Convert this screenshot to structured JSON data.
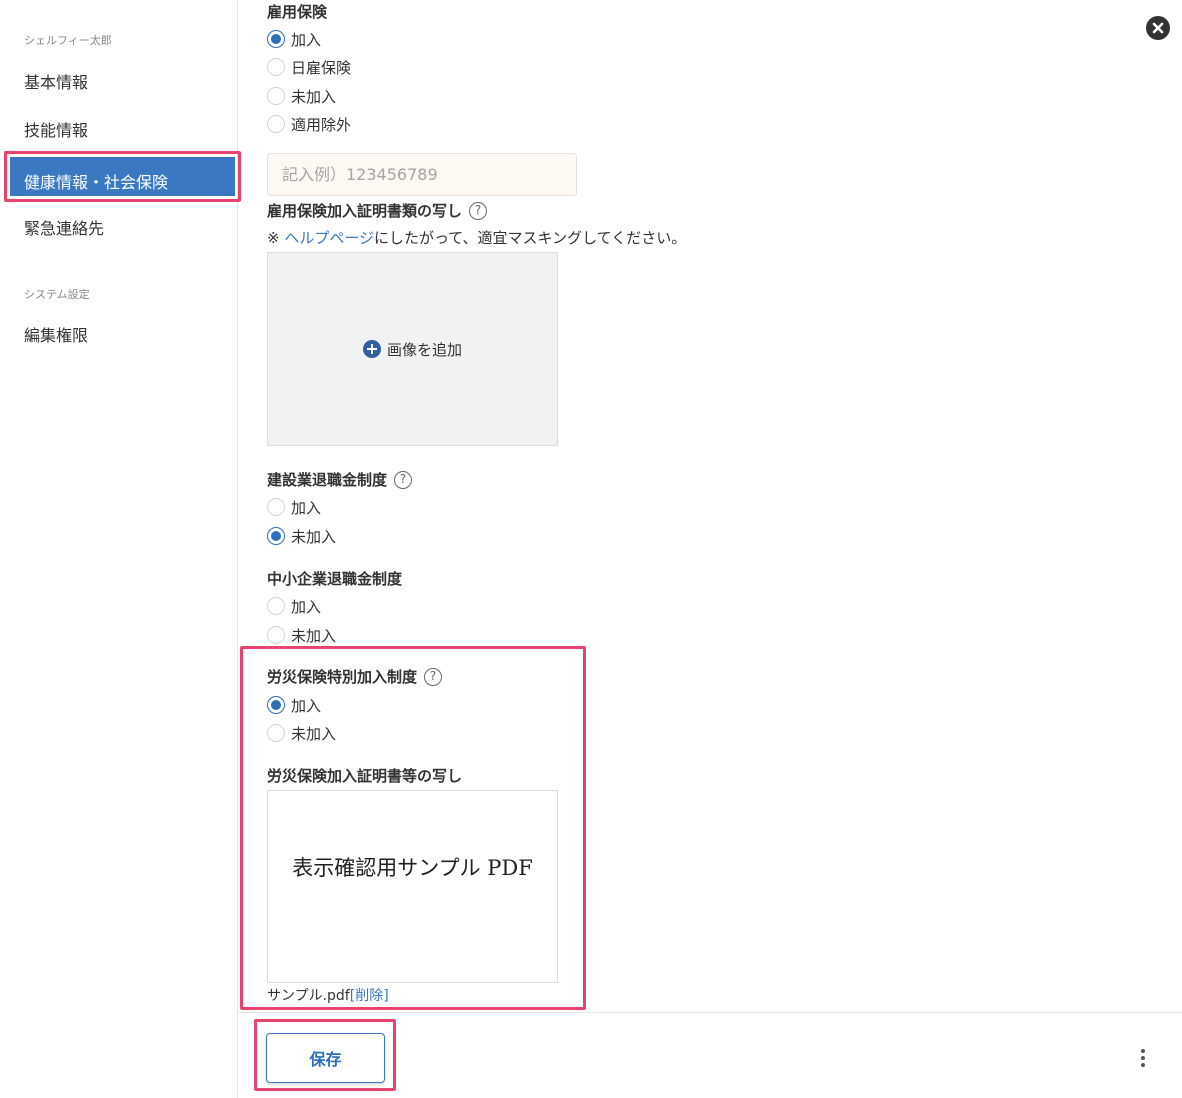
{
  "sidebar": {
    "section_user": "シェルフィー太郎",
    "items": [
      {
        "label": "基本情報"
      },
      {
        "label": "技能情報"
      },
      {
        "label": "健康情報・社会保険"
      },
      {
        "label": "緊急連絡先"
      }
    ],
    "section_system": "システム設定",
    "system_items": [
      {
        "label": "編集権限"
      }
    ]
  },
  "employment_insurance": {
    "title": "雇用保険",
    "options": [
      "加入",
      "日雇保険",
      "未加入",
      "適用除外"
    ],
    "selected": "加入",
    "number_placeholder": "記入例）123456789",
    "doc_title": "雇用保険加入証明書類の写し",
    "note_prefix": "※ ",
    "note_link": "ヘルプページ",
    "note_suffix": "にしたがって、適宜マスキングしてください。",
    "add_image_label": "画像を追加"
  },
  "construction_retirement": {
    "title": "建設業退職金制度",
    "options": [
      "加入",
      "未加入"
    ],
    "selected": "未加入"
  },
  "sme_retirement": {
    "title": "中小企業退職金制度",
    "options": [
      "加入",
      "未加入"
    ],
    "selected": ""
  },
  "workers_comp": {
    "title": "労災保険特別加入制度",
    "options": [
      "加入",
      "未加入"
    ],
    "selected": "加入",
    "doc_title": "労災保険加入証明書等の写し",
    "pdf_preview_text": "表示確認用サンプル PDF",
    "file_name": "サンプル.pdf",
    "delete_label": "[削除]"
  },
  "footer": {
    "save_label": "保存"
  },
  "icons": {
    "close": "close-icon",
    "help": "help-icon",
    "plus": "plus-circle-icon",
    "more": "more-vertical-icon"
  },
  "colors": {
    "accent": "#3b78c2",
    "highlight": "#e6436f",
    "input_bg": "#fdf8f2"
  }
}
